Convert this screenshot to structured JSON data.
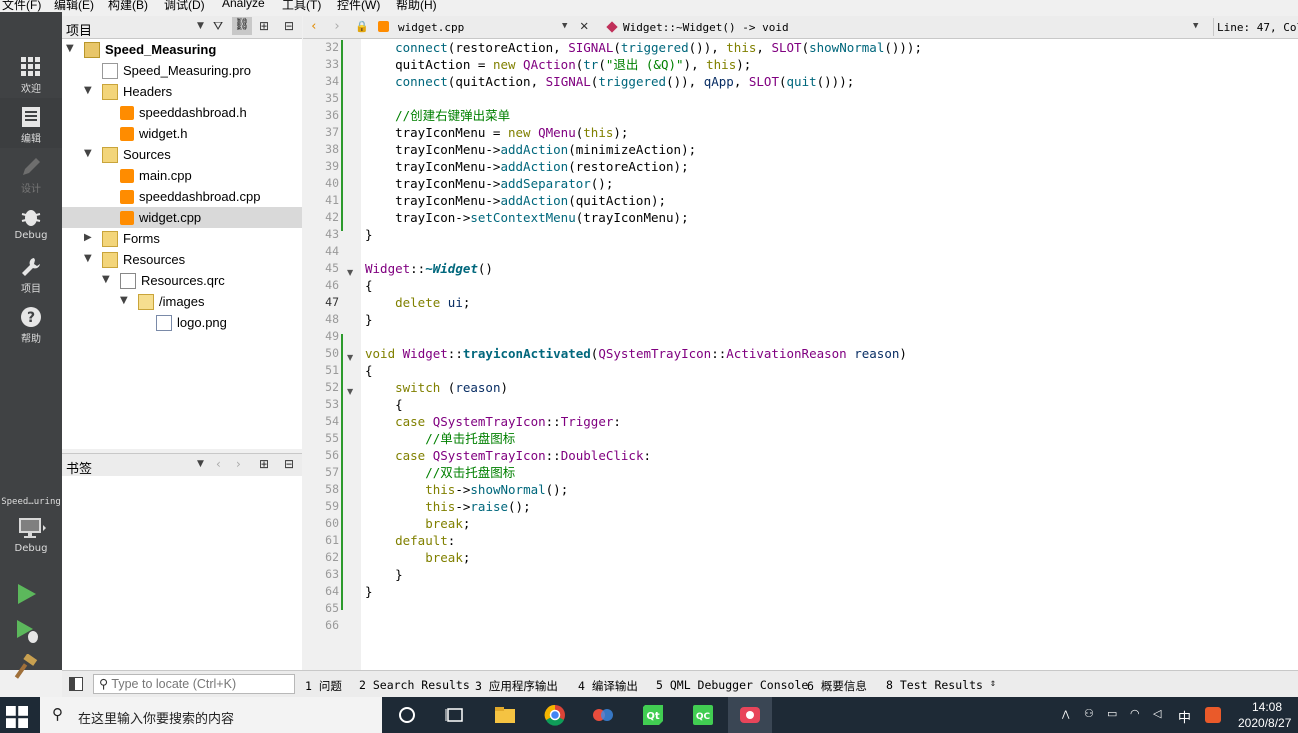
{
  "menu": [
    "文件(F)",
    "编辑(E)",
    "构建(B)",
    "调试(D)",
    "Analyze",
    "工具(T)",
    "控件(W)",
    "帮助(H)"
  ],
  "modes": {
    "welcome": "欢迎",
    "edit": "编辑",
    "design": "设计",
    "debug": "Debug",
    "projects": "项目",
    "help": "帮助"
  },
  "run_target": {
    "project": "Speed…uring",
    "config": "Debug"
  },
  "project_pane": {
    "title": "项目",
    "tree": [
      {
        "label": "Speed_Measuring",
        "bold": true
      },
      {
        "label": "Speed_Measuring.pro"
      },
      {
        "label": "Headers"
      },
      {
        "label": "speeddashbroad.h"
      },
      {
        "label": "widget.h"
      },
      {
        "label": "Sources"
      },
      {
        "label": "main.cpp"
      },
      {
        "label": "speeddashbroad.cpp"
      },
      {
        "label": "widget.cpp",
        "selected": true
      },
      {
        "label": "Forms"
      },
      {
        "label": "Resources"
      },
      {
        "label": "Resources.qrc"
      },
      {
        "label": "/images"
      },
      {
        "label": "logo.png"
      }
    ]
  },
  "bookmarks": {
    "title": "书签"
  },
  "editor": {
    "file": "widget.cpp",
    "symbol": "Widget::~Widget() -> void",
    "position": "Line: 47, Col",
    "lines": [
      {
        "n": "32",
        "html": "    connect(restoreAction, SIGNAL(triggered()), this, SLOT(showNormal()));"
      },
      {
        "n": "33",
        "html": "    quitAction = new QAction(tr(\"退出 (&Q)\"), this);"
      },
      {
        "n": "34",
        "html": "    connect(quitAction, SIGNAL(triggered()), qApp, SLOT(quit()));"
      },
      {
        "n": "35",
        "html": ""
      },
      {
        "n": "36",
        "html": "    //创建右键弹出菜单"
      },
      {
        "n": "37",
        "html": "    trayIconMenu = new QMenu(this);"
      },
      {
        "n": "38",
        "html": "    trayIconMenu->addAction(minimizeAction);"
      },
      {
        "n": "39",
        "html": "    trayIconMenu->addAction(restoreAction);"
      },
      {
        "n": "40",
        "html": "    trayIconMenu->addSeparator();"
      },
      {
        "n": "41",
        "html": "    trayIconMenu->addAction(quitAction);"
      },
      {
        "n": "42",
        "html": "    trayIcon->setContextMenu(trayIconMenu);"
      },
      {
        "n": "43",
        "html": "}"
      },
      {
        "n": "44",
        "html": ""
      },
      {
        "n": "45",
        "html": "Widget::~Widget()"
      },
      {
        "n": "46",
        "html": "{"
      },
      {
        "n": "47",
        "html": "    delete ui;"
      },
      {
        "n": "48",
        "html": "}"
      },
      {
        "n": "49",
        "html": ""
      },
      {
        "n": "50",
        "html": "void Widget::trayiconActivated(QSystemTrayIcon::ActivationReason reason)"
      },
      {
        "n": "51",
        "html": "{"
      },
      {
        "n": "52",
        "html": "    switch (reason)"
      },
      {
        "n": "53",
        "html": "    {"
      },
      {
        "n": "54",
        "html": "    case QSystemTrayIcon::Trigger:"
      },
      {
        "n": "55",
        "html": "        //单击托盘图标"
      },
      {
        "n": "56",
        "html": "    case QSystemTrayIcon::DoubleClick:"
      },
      {
        "n": "57",
        "html": "        //双击托盘图标"
      },
      {
        "n": "58",
        "html": "        this->showNormal();"
      },
      {
        "n": "59",
        "html": "        this->raise();"
      },
      {
        "n": "60",
        "html": "        break;"
      },
      {
        "n": "61",
        "html": "    default:"
      },
      {
        "n": "62",
        "html": "        break;"
      },
      {
        "n": "63",
        "html": "    }"
      },
      {
        "n": "64",
        "html": "}"
      },
      {
        "n": "65",
        "html": ""
      },
      {
        "n": "66",
        "html": ""
      }
    ]
  },
  "status": {
    "locator_placeholder": "Type to locate (Ctrl+K)",
    "panes": [
      "1 问题",
      "2 Search Results",
      "3 应用程序输出",
      "4 编译输出",
      "5 QML Debugger Console",
      "6 概要信息",
      "8 Test Results"
    ]
  },
  "taskbar": {
    "search_placeholder": "在这里输入你要搜索的内容",
    "ime": "中",
    "time": "14:08",
    "date": "2020/8/27"
  }
}
